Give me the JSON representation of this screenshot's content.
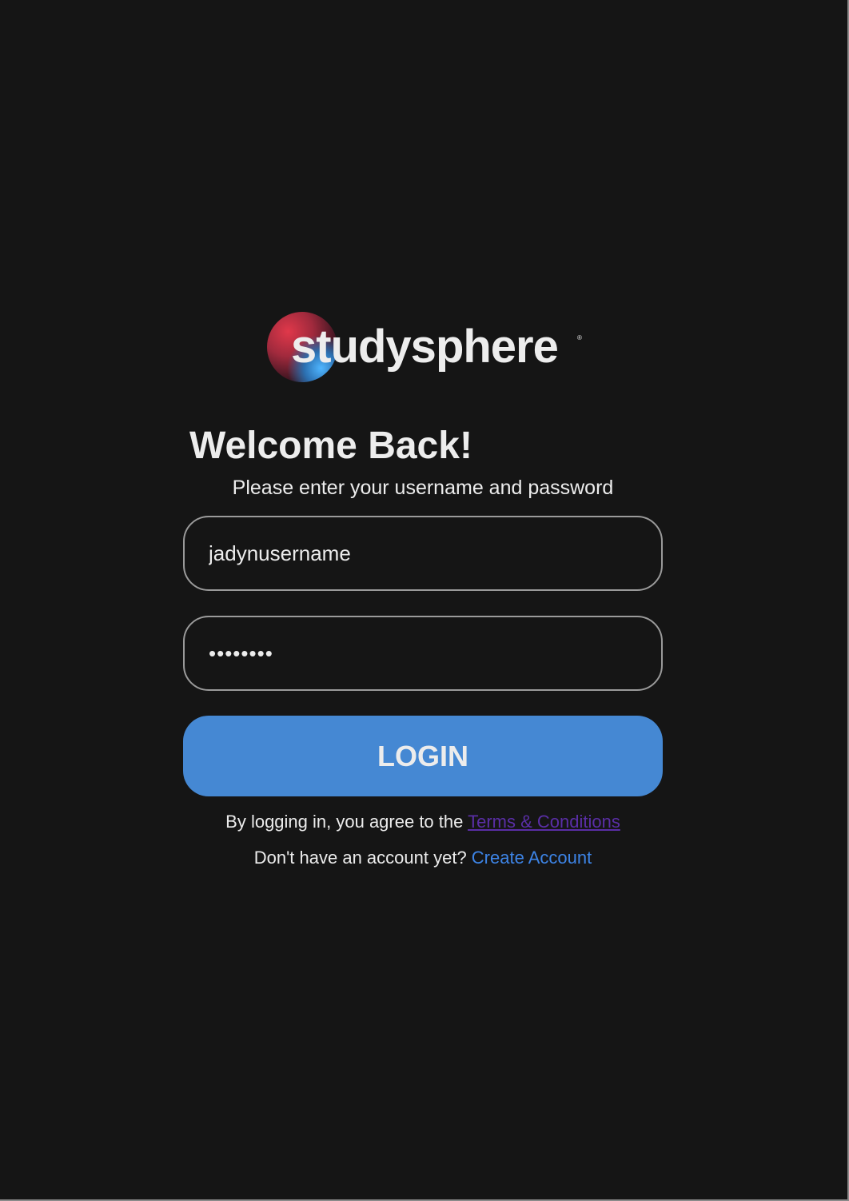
{
  "brand": {
    "name": "studysphere",
    "registered_mark": "®"
  },
  "login": {
    "title": "Welcome Back!",
    "subtitle": "Please enter your username and password",
    "username_value": "jadynusername",
    "password_value": "••••••••",
    "button_label": "LOGIN"
  },
  "terms": {
    "prefix": "By logging in, you agree to the ",
    "link_label": "Terms & Conditions"
  },
  "signup": {
    "prefix": "Don't have an account yet? ",
    "link_label": "Create Account"
  },
  "colors": {
    "background": "#151515",
    "button": "#4588d3",
    "terms_link": "#5a2ea6",
    "create_link": "#3d84e6"
  }
}
